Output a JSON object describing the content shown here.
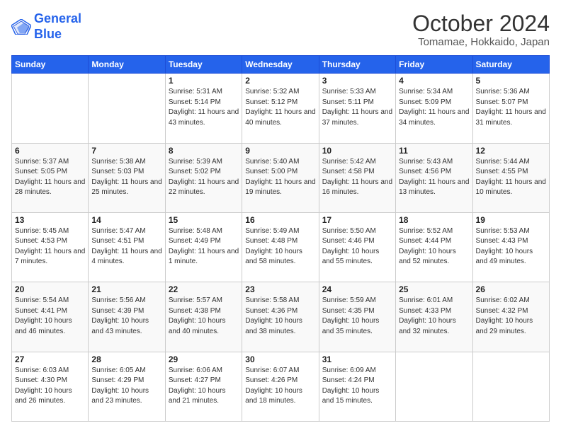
{
  "header": {
    "logo_line1": "General",
    "logo_line2": "Blue",
    "month": "October 2024",
    "location": "Tomamae, Hokkaido, Japan"
  },
  "weekdays": [
    "Sunday",
    "Monday",
    "Tuesday",
    "Wednesday",
    "Thursday",
    "Friday",
    "Saturday"
  ],
  "weeks": [
    [
      {
        "day": "",
        "info": ""
      },
      {
        "day": "",
        "info": ""
      },
      {
        "day": "1",
        "info": "Sunrise: 5:31 AM\nSunset: 5:14 PM\nDaylight: 11 hours and 43 minutes."
      },
      {
        "day": "2",
        "info": "Sunrise: 5:32 AM\nSunset: 5:12 PM\nDaylight: 11 hours and 40 minutes."
      },
      {
        "day": "3",
        "info": "Sunrise: 5:33 AM\nSunset: 5:11 PM\nDaylight: 11 hours and 37 minutes."
      },
      {
        "day": "4",
        "info": "Sunrise: 5:34 AM\nSunset: 5:09 PM\nDaylight: 11 hours and 34 minutes."
      },
      {
        "day": "5",
        "info": "Sunrise: 5:36 AM\nSunset: 5:07 PM\nDaylight: 11 hours and 31 minutes."
      }
    ],
    [
      {
        "day": "6",
        "info": "Sunrise: 5:37 AM\nSunset: 5:05 PM\nDaylight: 11 hours and 28 minutes."
      },
      {
        "day": "7",
        "info": "Sunrise: 5:38 AM\nSunset: 5:03 PM\nDaylight: 11 hours and 25 minutes."
      },
      {
        "day": "8",
        "info": "Sunrise: 5:39 AM\nSunset: 5:02 PM\nDaylight: 11 hours and 22 minutes."
      },
      {
        "day": "9",
        "info": "Sunrise: 5:40 AM\nSunset: 5:00 PM\nDaylight: 11 hours and 19 minutes."
      },
      {
        "day": "10",
        "info": "Sunrise: 5:42 AM\nSunset: 4:58 PM\nDaylight: 11 hours and 16 minutes."
      },
      {
        "day": "11",
        "info": "Sunrise: 5:43 AM\nSunset: 4:56 PM\nDaylight: 11 hours and 13 minutes."
      },
      {
        "day": "12",
        "info": "Sunrise: 5:44 AM\nSunset: 4:55 PM\nDaylight: 11 hours and 10 minutes."
      }
    ],
    [
      {
        "day": "13",
        "info": "Sunrise: 5:45 AM\nSunset: 4:53 PM\nDaylight: 11 hours and 7 minutes."
      },
      {
        "day": "14",
        "info": "Sunrise: 5:47 AM\nSunset: 4:51 PM\nDaylight: 11 hours and 4 minutes."
      },
      {
        "day": "15",
        "info": "Sunrise: 5:48 AM\nSunset: 4:49 PM\nDaylight: 11 hours and 1 minute."
      },
      {
        "day": "16",
        "info": "Sunrise: 5:49 AM\nSunset: 4:48 PM\nDaylight: 10 hours and 58 minutes."
      },
      {
        "day": "17",
        "info": "Sunrise: 5:50 AM\nSunset: 4:46 PM\nDaylight: 10 hours and 55 minutes."
      },
      {
        "day": "18",
        "info": "Sunrise: 5:52 AM\nSunset: 4:44 PM\nDaylight: 10 hours and 52 minutes."
      },
      {
        "day": "19",
        "info": "Sunrise: 5:53 AM\nSunset: 4:43 PM\nDaylight: 10 hours and 49 minutes."
      }
    ],
    [
      {
        "day": "20",
        "info": "Sunrise: 5:54 AM\nSunset: 4:41 PM\nDaylight: 10 hours and 46 minutes."
      },
      {
        "day": "21",
        "info": "Sunrise: 5:56 AM\nSunset: 4:39 PM\nDaylight: 10 hours and 43 minutes."
      },
      {
        "day": "22",
        "info": "Sunrise: 5:57 AM\nSunset: 4:38 PM\nDaylight: 10 hours and 40 minutes."
      },
      {
        "day": "23",
        "info": "Sunrise: 5:58 AM\nSunset: 4:36 PM\nDaylight: 10 hours and 38 minutes."
      },
      {
        "day": "24",
        "info": "Sunrise: 5:59 AM\nSunset: 4:35 PM\nDaylight: 10 hours and 35 minutes."
      },
      {
        "day": "25",
        "info": "Sunrise: 6:01 AM\nSunset: 4:33 PM\nDaylight: 10 hours and 32 minutes."
      },
      {
        "day": "26",
        "info": "Sunrise: 6:02 AM\nSunset: 4:32 PM\nDaylight: 10 hours and 29 minutes."
      }
    ],
    [
      {
        "day": "27",
        "info": "Sunrise: 6:03 AM\nSunset: 4:30 PM\nDaylight: 10 hours and 26 minutes."
      },
      {
        "day": "28",
        "info": "Sunrise: 6:05 AM\nSunset: 4:29 PM\nDaylight: 10 hours and 23 minutes."
      },
      {
        "day": "29",
        "info": "Sunrise: 6:06 AM\nSunset: 4:27 PM\nDaylight: 10 hours and 21 minutes."
      },
      {
        "day": "30",
        "info": "Sunrise: 6:07 AM\nSunset: 4:26 PM\nDaylight: 10 hours and 18 minutes."
      },
      {
        "day": "31",
        "info": "Sunrise: 6:09 AM\nSunset: 4:24 PM\nDaylight: 10 hours and 15 minutes."
      },
      {
        "day": "",
        "info": ""
      },
      {
        "day": "",
        "info": ""
      }
    ]
  ]
}
